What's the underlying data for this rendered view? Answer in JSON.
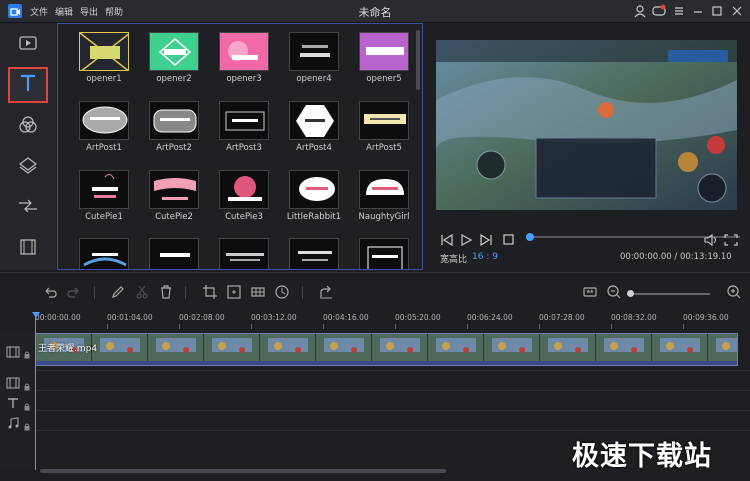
{
  "window": {
    "title": "未命名",
    "menu": [
      "文件",
      "编辑",
      "导出",
      "帮助"
    ]
  },
  "left_toolbar": {
    "items": [
      {
        "name": "media",
        "icon": "media-icon"
      },
      {
        "name": "text",
        "icon": "text-icon",
        "active": true
      },
      {
        "name": "filters",
        "icon": "filters-icon"
      },
      {
        "name": "overlay",
        "icon": "layers-icon"
      },
      {
        "name": "transitions",
        "icon": "transition-icon"
      },
      {
        "name": "elements",
        "icon": "film-icon"
      }
    ]
  },
  "text_templates": {
    "rows": [
      [
        "opener1",
        "opener2",
        "opener3",
        "opener4",
        "opener5"
      ],
      [
        "ArtPost1",
        "ArtPost2",
        "ArtPost3",
        "ArtPost4",
        "ArtPost5"
      ],
      [
        "CutePie1",
        "CutePie2",
        "CutePie3",
        "LittleRabbit1",
        "NaughtyGirl"
      ]
    ]
  },
  "preview": {
    "aspect_label": "宽高比",
    "aspect_value": "16 : 9",
    "time": "00:00:00.00 / 00:13:19.10",
    "progress": 0.0
  },
  "timeline": {
    "ruler": [
      "00:00:00.00",
      "00:01:04.00",
      "00:02:08.00",
      "00:03:12.00",
      "00:04:16.00",
      "00:05:20.00",
      "00:06:24.00",
      "00:07:28.00",
      "00:08:32.00",
      "00:09:36.00"
    ],
    "clip_name": "王者荣耀.mp4",
    "zoom": 0.0
  },
  "watermark": "极速下载站",
  "colors": {
    "accent": "#4b9cff",
    "active_border": "#e0463d",
    "background": "#1e1f23"
  }
}
